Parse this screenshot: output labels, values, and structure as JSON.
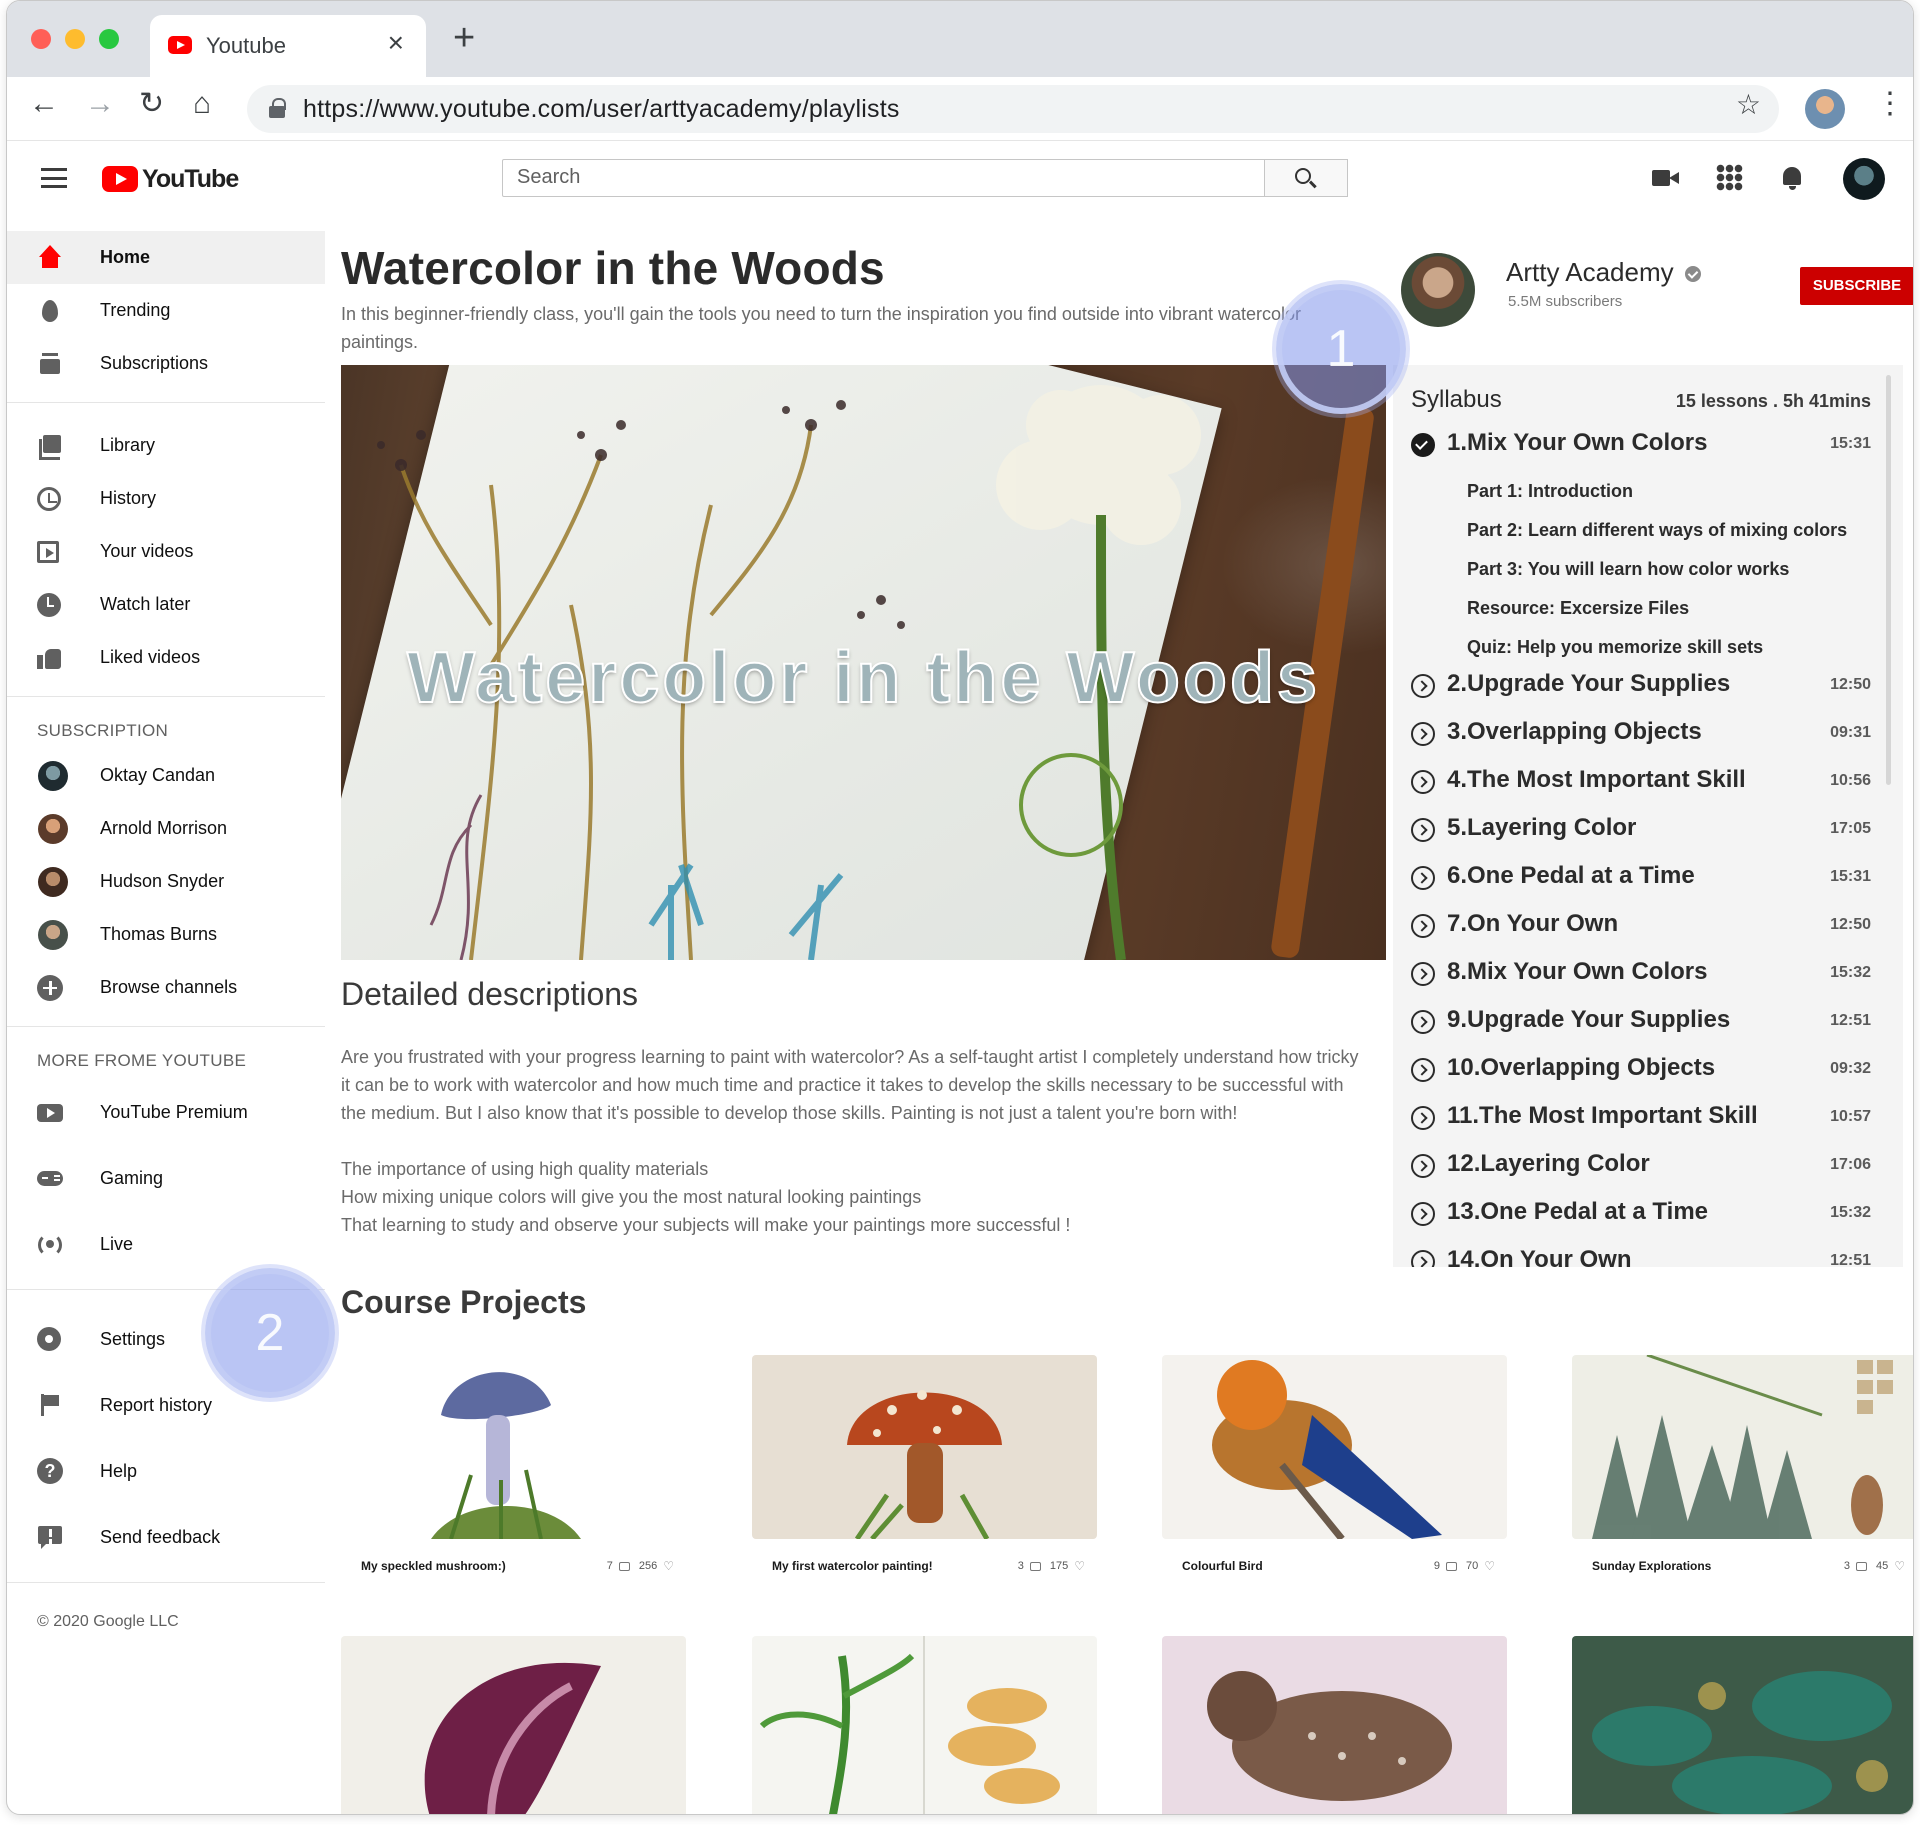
{
  "browser": {
    "tab_title": "Youtube",
    "close_label": "×",
    "new_tab_label": "+",
    "url": "https://www.youtube.com/user/arttyacademy/playlists"
  },
  "header": {
    "logo_text": "YouTube",
    "search_placeholder": "Search"
  },
  "sidebar": {
    "primary": [
      {
        "label": "Home",
        "icon": "home-icon",
        "active": true
      },
      {
        "label": "Trending",
        "icon": "flame-icon"
      },
      {
        "label": "Subscriptions",
        "icon": "subscriptions-icon"
      }
    ],
    "library": [
      {
        "label": "Library",
        "icon": "library-icon"
      },
      {
        "label": "History",
        "icon": "history-icon"
      },
      {
        "label": "Your videos",
        "icon": "your-videos-icon"
      },
      {
        "label": "Watch later",
        "icon": "clock-icon"
      },
      {
        "label": "Liked videos",
        "icon": "thumbs-up-icon"
      }
    ],
    "subscription_heading": "SUBSCRIPTION",
    "subscriptions": [
      {
        "label": "Oktay Candan"
      },
      {
        "label": "Arnold Morrison"
      },
      {
        "label": "Hudson Snyder"
      },
      {
        "label": "Thomas Burns"
      },
      {
        "label": "Browse channels",
        "icon": "plus-circle-icon"
      }
    ],
    "more_heading": "MORE FROME YOUTUBE",
    "more": [
      {
        "label": "YouTube Premium",
        "icon": "youtube-premium-icon"
      },
      {
        "label": "Gaming",
        "icon": "gaming-icon"
      },
      {
        "label": "Live",
        "icon": "live-icon"
      }
    ],
    "settings": [
      {
        "label": "Settings",
        "icon": "gear-icon"
      },
      {
        "label": "Report history",
        "icon": "flag-icon"
      },
      {
        "label": "Help",
        "icon": "help-icon",
        "glyph": "?"
      },
      {
        "label": "Send feedback",
        "icon": "feedback-icon"
      }
    ],
    "copyright": "© 2020 Google LLC"
  },
  "main": {
    "title": "Watercolor in the Woods",
    "intro": "In this beginner-friendly class, you'll gain the tools you need to turn the inspiration you find outside into vibrant watercolor paintings.",
    "hero_text": "Watercolor in the Woods",
    "description_title": "Detailed descriptions",
    "description_paragraph": "Are you frustrated with your progress learning to paint with watercolor? As a self-taught artist I completely understand how tricky it can be to work with watercolor and how much time and practice it takes to develop the skills necessary to be successful with the medium. But I also know that it's possible to develop those skills. Painting is not just a talent you're born with!",
    "description_points": [
      "The importance of using high quality materials",
      "How mixing unique colors will give you the most natural looking paintings",
      "That learning to study and observe your subjects will make your paintings more successful !"
    ],
    "projects_title": "Course Projects"
  },
  "channel": {
    "name": "Artty Academy",
    "subscribers": "5.5M subscribers",
    "subscribe_label": "SUBSCRIBE"
  },
  "syllabus": {
    "heading": "Syllabus",
    "meta": "15 lessons . 5h 41mins",
    "lessons": [
      {
        "title": "1.Mix Your Own Colors",
        "time": "15:31",
        "completed": true
      },
      {
        "title": "2.Upgrade Your Supplies",
        "time": "12:50"
      },
      {
        "title": "3.Overlapping Objects",
        "time": "09:31"
      },
      {
        "title": "4.The Most Important Skill",
        "time": "10:56"
      },
      {
        "title": "5.Layering Color",
        "time": "17:05"
      },
      {
        "title": "6.One Pedal at a Time",
        "time": "15:31"
      },
      {
        "title": "7.On Your Own",
        "time": "12:50"
      },
      {
        "title": "8.Mix Your Own Colors",
        "time": "15:32"
      },
      {
        "title": "9.Upgrade Your Supplies",
        "time": "12:51"
      },
      {
        "title": "10.Overlapping Objects",
        "time": "09:32"
      },
      {
        "title": "11.The Most Important Skill",
        "time": "10:57"
      },
      {
        "title": "12.Layering Color",
        "time": "17:06"
      },
      {
        "title": "13.One Pedal at a Time",
        "time": "15:32"
      },
      {
        "title": "14.On Your Own",
        "time": "12:51"
      }
    ],
    "sublessons": [
      "Part 1: Introduction",
      "Part 2: Learn different ways of mixing colors",
      "Part 3: You will learn how color works",
      "Resource: Excersize Files",
      "Quiz: Help you memorize skill sets"
    ]
  },
  "projects": [
    {
      "title": "My speckled mushroom:)",
      "comments": "7",
      "likes": "256"
    },
    {
      "title": "My first watercolor painting!",
      "comments": "3",
      "likes": "175"
    },
    {
      "title": "Colourful Bird",
      "comments": "9",
      "likes": "70"
    },
    {
      "title": "Sunday Explorations",
      "comments": "3",
      "likes": "45"
    }
  ],
  "steps": [
    "1",
    "2"
  ],
  "colors": {
    "accent": "#ff0000",
    "subscribe": "#cc0000",
    "marker": "#8296eb"
  }
}
